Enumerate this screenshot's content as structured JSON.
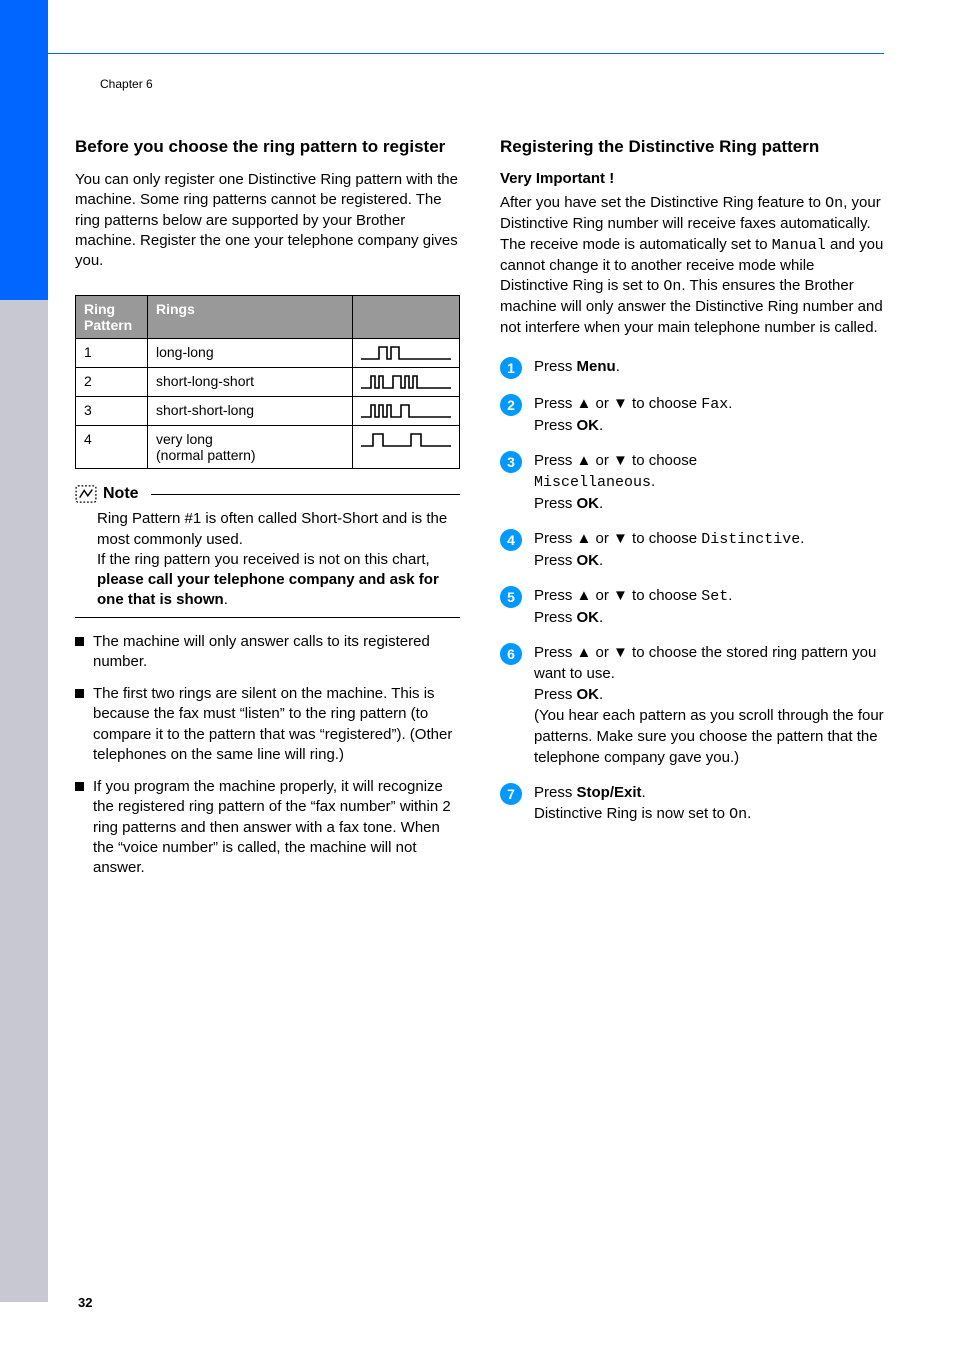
{
  "chapter": "Chapter 6",
  "page_number": "32",
  "left": {
    "heading": "Before you choose the ring pattern to register",
    "intro": "You can only register one Distinctive Ring pattern with the machine. Some ring patterns cannot be registered. The ring patterns below are supported by your Brother machine. Register the one your telephone company gives you.",
    "table": {
      "headers": [
        "Ring Pattern",
        "Rings",
        ""
      ],
      "rows": [
        [
          "1",
          "long-long"
        ],
        [
          "2",
          "short-long-short"
        ],
        [
          "3",
          "short-short-long"
        ],
        [
          "4",
          "very long\n(normal pattern)"
        ]
      ]
    },
    "note_label": "Note",
    "note_body_1": "Ring Pattern #1 is often called Short-Short and is the most commonly used.",
    "note_body_2a": "If the ring pattern you received is not on this chart, ",
    "note_body_2b": "please call your telephone company and ask for one that is shown",
    "note_body_2c": ".",
    "bullets": [
      "The machine will only answer calls to its registered number.",
      "The first two rings are silent on the machine. This is because the fax must “listen” to the ring pattern (to compare it to the pattern that was “registered”). (Other telephones on the same line will ring.)",
      "If you program the machine properly, it will recognize the registered ring pattern of the “fax number” within 2 ring patterns and then answer with a fax tone. When the “voice number” is called, the machine will not answer."
    ]
  },
  "right": {
    "heading": "Registering the Distinctive Ring pattern",
    "sub": "Very Important !",
    "intro_1": "After you have set the Distinctive Ring feature to ",
    "intro_on1": "On",
    "intro_2": ", your Distinctive Ring number will receive faxes automatically. The receive mode is automatically set to ",
    "intro_manual": "Manual",
    "intro_3": " and you cannot change it to another receive mode while Distinctive Ring is set to ",
    "intro_on2": "On",
    "intro_4": ". This ensures the Brother machine will only answer the Distinctive Ring number and not interfere when your main telephone number is called.",
    "steps": {
      "s1": {
        "num": "1",
        "a": "Press ",
        "b": "Menu",
        "c": "."
      },
      "s2": {
        "num": "2",
        "a": "Press ▲ or ▼ to choose ",
        "code": "Fax",
        "b": ".",
        "line2a": "Press ",
        "line2b": "OK",
        "line2c": "."
      },
      "s3": {
        "num": "3",
        "a": "Press ▲ or ▼ to choose",
        "code": "Miscellaneous",
        "b": ".",
        "line2a": "Press ",
        "line2b": "OK",
        "line2c": "."
      },
      "s4": {
        "num": "4",
        "a": "Press ▲ or ▼ to choose ",
        "code": "Distinctive",
        "b": ".",
        "line2a": "Press ",
        "line2b": "OK",
        "line2c": "."
      },
      "s5": {
        "num": "5",
        "a": "Press ▲ or ▼ to choose ",
        "code": "Set",
        "b": ".",
        "line2a": "Press ",
        "line2b": "OK",
        "line2c": "."
      },
      "s6": {
        "num": "6",
        "a": "Press ▲ or ▼ to choose the stored ring pattern you want to use.",
        "line2a": "Press ",
        "line2b": "OK",
        "line2c": ".",
        "paren": "(You hear each pattern as you scroll through the four patterns. Make sure you choose the pattern that the telephone company gave you.)"
      },
      "s7": {
        "num": "7",
        "a": "Press ",
        "b": "Stop/Exit",
        "c": ".",
        "line2a": "Distinctive Ring is now set to ",
        "line2code": "On",
        "line2b": "."
      }
    }
  }
}
